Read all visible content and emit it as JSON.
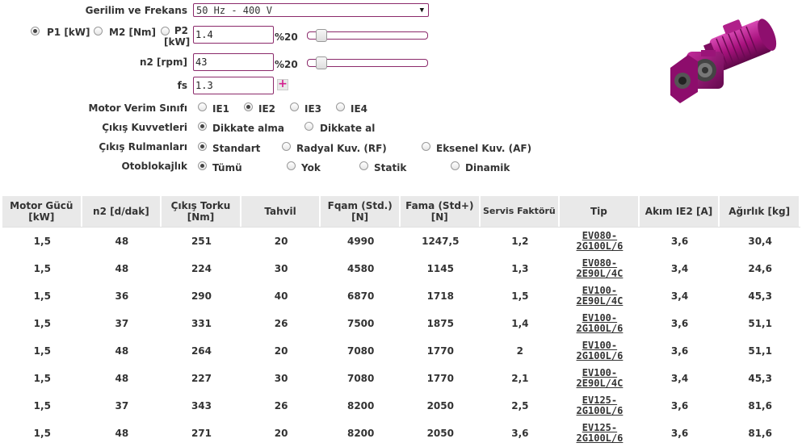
{
  "form": {
    "voltage_label": "Gerilim ve Frekans",
    "voltage_value": "50 Hz - 400 V",
    "power_options": [
      {
        "label": "P1 [kW]",
        "selected": true
      },
      {
        "label": "M2 [Nm]",
        "selected": false
      },
      {
        "label": "P2\n[kW]",
        "selected": false
      }
    ],
    "power_value": "1.4",
    "power_percent": "%20",
    "n2_label": "n2 [rpm]",
    "n2_value": "43",
    "n2_percent": "%20",
    "fs_label": "fs",
    "fs_value": "1.3",
    "efficiency_label": "Motor Verim Sınıfı",
    "efficiency_options": [
      {
        "label": "IE1",
        "selected": false
      },
      {
        "label": "IE2",
        "selected": true
      },
      {
        "label": "IE3",
        "selected": false
      },
      {
        "label": "IE4",
        "selected": false
      }
    ],
    "output_forces_label": "Çıkış Kuvvetleri",
    "output_forces_options": [
      {
        "label": "Dikkate alma",
        "selected": true
      },
      {
        "label": "Dikkate al",
        "selected": false
      }
    ],
    "bearings_label": "Çıkış Rulmanları",
    "bearings_options": [
      {
        "label": "Standart",
        "selected": true
      },
      {
        "label": "Radyal Kuv. (RF)",
        "selected": false
      },
      {
        "label": "Eksenel Kuv. (AF)",
        "selected": false
      }
    ],
    "selflock_label": "Otoblokajlık",
    "selflock_options": [
      {
        "label": "Tümü",
        "selected": true
      },
      {
        "label": "Yok",
        "selected": false
      },
      {
        "label": "Statik",
        "selected": false
      },
      {
        "label": "Dinamik",
        "selected": false
      }
    ],
    "accent_color": "#8b2a6b",
    "plus_color": "#d4208f"
  },
  "table": {
    "headers": [
      "Motor Gücü\n[kW]",
      "n2 [d/dak]",
      "Çıkış Torku\n[Nm]",
      "Tahvil",
      "Fqam (Std.)\n[N]",
      "Fama (Std+)\n[N]",
      "Servis Faktörü",
      "Tip",
      "Akım IE2 [A]",
      "Ağırlık [kg]"
    ],
    "rows": [
      [
        "1,5",
        "48",
        "251",
        "20",
        "4990",
        "1247,5",
        "1,2",
        "EV080-\n2G100L/6",
        "3,6",
        "30,4"
      ],
      [
        "1,5",
        "48",
        "224",
        "30",
        "4580",
        "1145",
        "1,3",
        "EV080-\n2E90L/4C",
        "3,4",
        "24,6"
      ],
      [
        "1,5",
        "36",
        "290",
        "40",
        "6870",
        "1718",
        "1,5",
        "EV100-\n2E90L/4C",
        "3,4",
        "45,3"
      ],
      [
        "1,5",
        "37",
        "331",
        "26",
        "7500",
        "1875",
        "1,4",
        "EV100-\n2G100L/6",
        "3,6",
        "51,1"
      ],
      [
        "1,5",
        "48",
        "264",
        "20",
        "7080",
        "1770",
        "2",
        "EV100-\n2G100L/6",
        "3,6",
        "51,1"
      ],
      [
        "1,5",
        "48",
        "227",
        "30",
        "7080",
        "1770",
        "2,1",
        "EV100-\n2E90L/4C",
        "3,4",
        "45,3"
      ],
      [
        "1,5",
        "37",
        "343",
        "26",
        "8200",
        "2050",
        "2,5",
        "EV125-\n2G100L/6",
        "3,6",
        "81,6"
      ],
      [
        "1,5",
        "48",
        "271",
        "20",
        "8200",
        "2050",
        "3,6",
        "EV125-\n2G100L/6",
        "3,6",
        "81,6"
      ]
    ]
  }
}
